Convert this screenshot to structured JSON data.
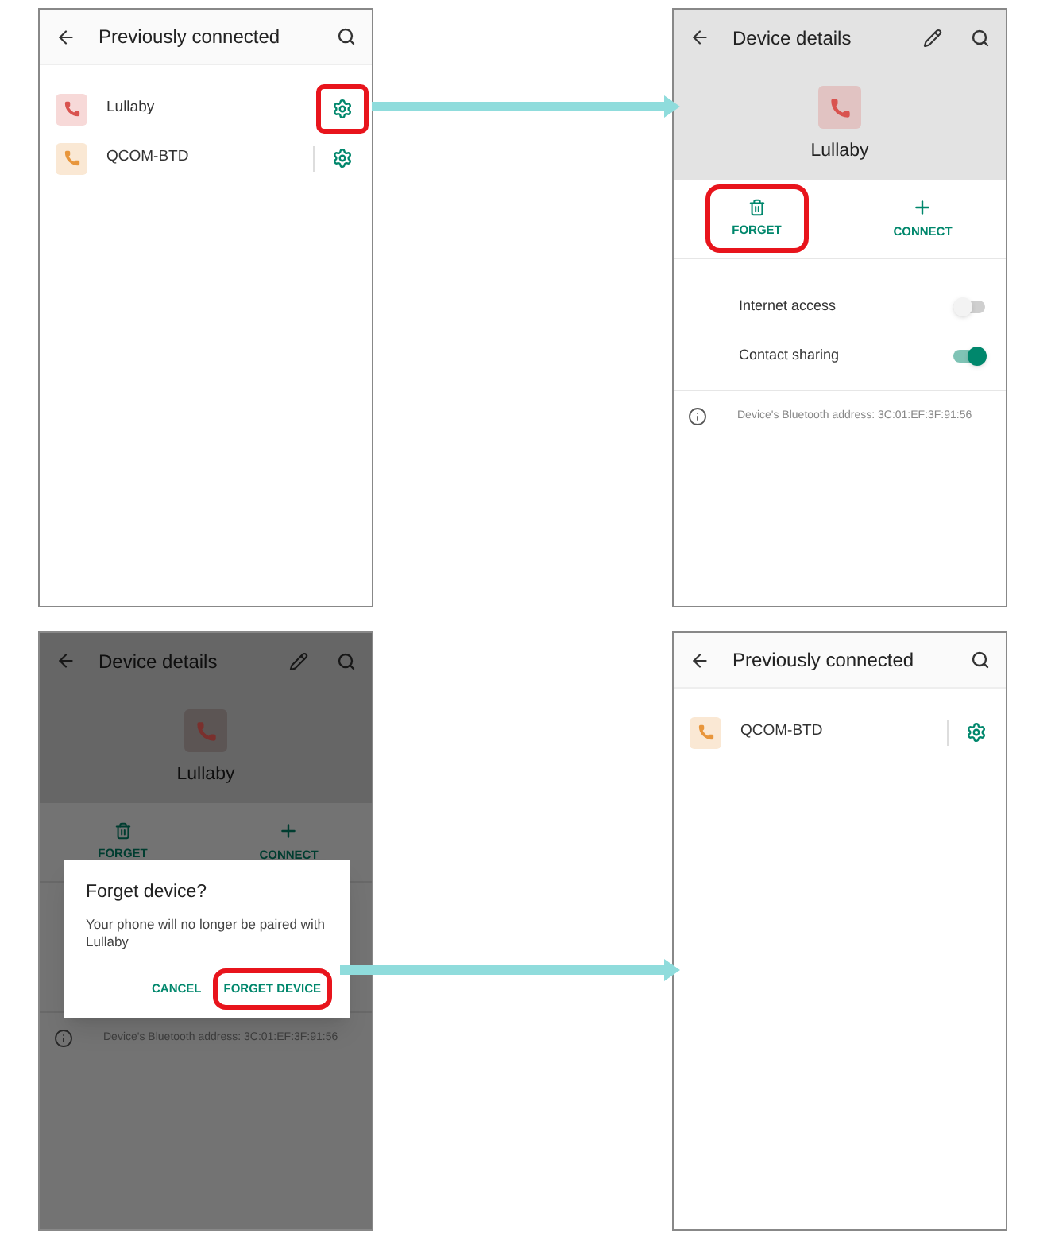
{
  "screens": [
    {
      "kind": "device_list",
      "title": "Previously connected",
      "devices": [
        {
          "name": "Lullaby",
          "color": "#d9534f",
          "highlighted": true
        },
        {
          "name": "QCOM-BTD",
          "color": "#e8963c",
          "highlighted": false
        }
      ]
    },
    {
      "kind": "device_details",
      "title": "Device details",
      "dimmed": false,
      "device": {
        "name": "Lullaby",
        "color": "#d9534f"
      },
      "actions": [
        {
          "label": "FORGET",
          "kind": "forget",
          "highlighted": true
        },
        {
          "label": "CONNECT",
          "kind": "connect",
          "highlighted": false
        }
      ],
      "settings": [
        {
          "label": "Internet access",
          "on": false
        },
        {
          "label": "Contact sharing",
          "on": true
        }
      ],
      "info": "Device's Bluetooth address: 3C:01:EF:3F:91:56"
    },
    {
      "kind": "device_details",
      "title": "Device details",
      "dimmed": true,
      "device": {
        "name": "Lullaby",
        "color": "#7a302d"
      },
      "actions": [
        {
          "label": "FORGET",
          "kind": "forget",
          "highlighted": false
        },
        {
          "label": "CONNECT",
          "kind": "connect",
          "highlighted": false
        }
      ],
      "info": "Device's Bluetooth address: 3C:01:EF:3F:91:56",
      "dialog": {
        "title": "Forget device?",
        "message": "Your phone will no longer be paired with Lullaby",
        "buttons": [
          {
            "label": "CANCEL",
            "highlighted": false
          },
          {
            "label": "FORGET DEVICE",
            "highlighted": true
          }
        ]
      }
    },
    {
      "kind": "device_list",
      "title": "Previously connected",
      "devices": [
        {
          "name": "QCOM-BTD",
          "color": "#e8963c",
          "highlighted": false
        }
      ]
    }
  ]
}
